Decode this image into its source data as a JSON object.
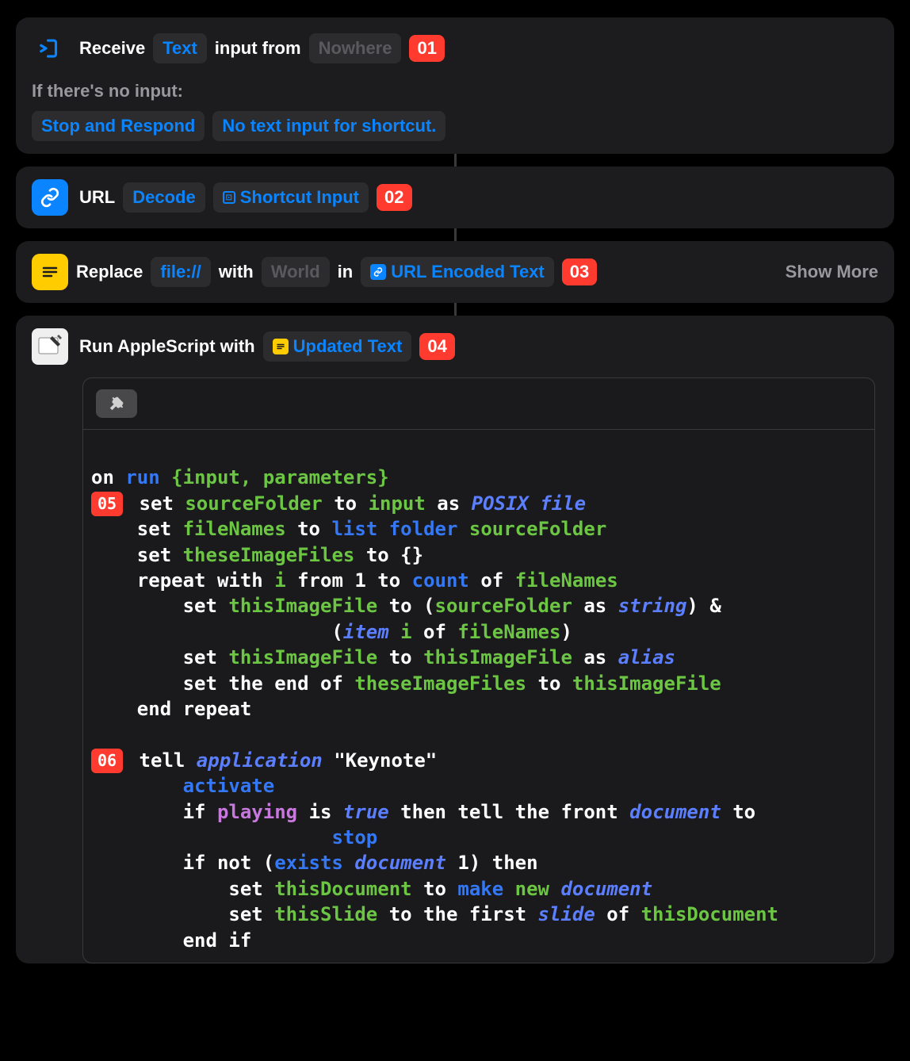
{
  "step1": {
    "prefix": "Receive",
    "type_token": "Text",
    "mid": "input from",
    "source_token": "Nowhere",
    "badge": "01",
    "sublabel": "If there's no input:",
    "action_token": "Stop and Respond",
    "message_token": "No text input for shortcut."
  },
  "step2": {
    "title": "URL",
    "action_token": "Decode",
    "input_token": "Shortcut Input",
    "badge": "02"
  },
  "step3": {
    "title": "Replace",
    "find_token": "file://",
    "mid1": "with",
    "replace_token": "World",
    "mid2": "in",
    "input_token": "URL Encoded Text",
    "badge": "03",
    "show_more": "Show More"
  },
  "step4": {
    "title": "Run AppleScript with",
    "input_token": "Updated Text",
    "badge": "04"
  },
  "code": {
    "badge5": "05",
    "badge6": "06",
    "line1_on": "on",
    "line1_run": "run",
    "line1_params": "{input, parameters}",
    "l2": {
      "set": "set",
      "sourceFolder": "sourceFolder",
      "to": "to",
      "input": "input",
      "as": "as",
      "posix": "POSIX file"
    },
    "l3": {
      "set": "set",
      "fileNames": "fileNames",
      "to": "to",
      "list": "list folder",
      "sourceFolder": "sourceFolder"
    },
    "l4": {
      "set": "set",
      "these": "theseImageFiles",
      "to": "to",
      "braces": "{}"
    },
    "l5": {
      "repeat": "repeat with",
      "i": "i",
      "from": "from",
      "one": "1",
      "to": "to",
      "count": "count",
      "of": "of",
      "fileNames": "fileNames"
    },
    "l6": {
      "set": "set",
      "thisImageFile": "thisImageFile",
      "to": "to",
      "sourceFolder": "sourceFolder",
      "as": "as",
      "string": "string",
      "amp": "&"
    },
    "l7": {
      "item": "item",
      "i": "i",
      "of": "of",
      "fileNames": "fileNames"
    },
    "l8": {
      "set": "set",
      "thisImageFile": "thisImageFile",
      "to": "to",
      "thisImageFile2": "thisImageFile",
      "as": "as",
      "alias": "alias"
    },
    "l9": {
      "set": "set the end of",
      "these": "theseImageFiles",
      "to": "to",
      "thisImageFile": "thisImageFile"
    },
    "l10": {
      "end": "end repeat"
    },
    "l11": {
      "tell": "tell",
      "application": "application",
      "keynote": "\"Keynote\""
    },
    "l12": {
      "activate": "activate"
    },
    "l13": {
      "if": "if",
      "playing": "playing",
      "is": "is",
      "true": "true",
      "then": "then tell the front",
      "document": "document",
      "to": "to"
    },
    "l14": {
      "stop": "stop"
    },
    "l15": {
      "ifnot": "if not (",
      "exists": "exists",
      "document": "document",
      "one": "1) then"
    },
    "l16": {
      "set": "set",
      "thisDocument": "thisDocument",
      "to": "to",
      "make": "make",
      "new": "new",
      "document": "document"
    },
    "l17": {
      "set": "set",
      "thisSlide": "thisSlide",
      "to": "to the first",
      "slide": "slide",
      "of": "of",
      "thisDocument": "thisDocument"
    },
    "l18": {
      "endif": "end if"
    }
  }
}
